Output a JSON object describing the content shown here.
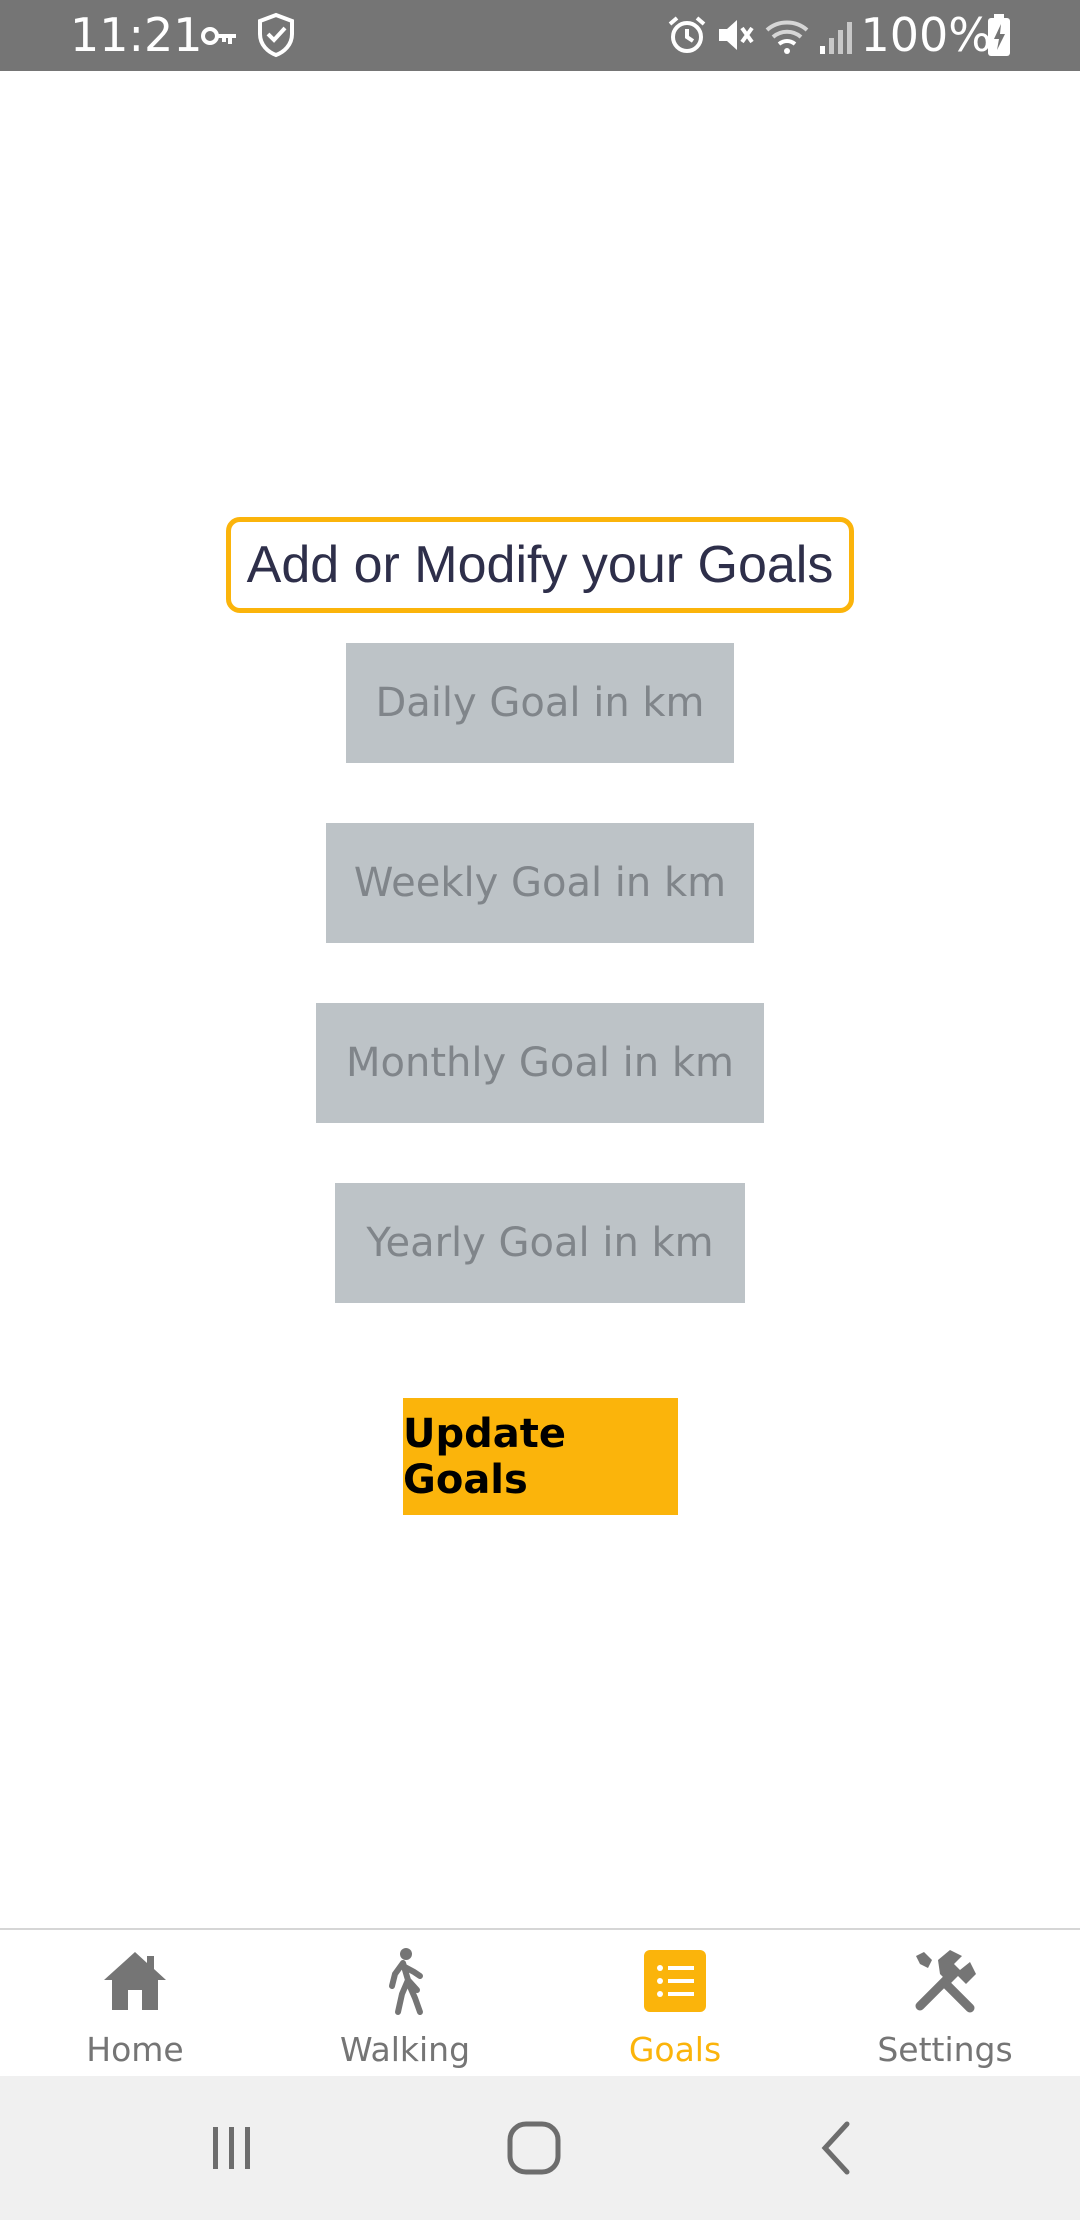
{
  "status_bar": {
    "time": "11:21",
    "battery": "100%",
    "icons": [
      "key-icon",
      "shield-check-icon",
      "alarm-icon",
      "mute-icon",
      "wifi-icon",
      "signal-icon",
      "battery-charging-icon"
    ]
  },
  "main": {
    "title": "Add or Modify your Goals",
    "daily_placeholder": "Daily Goal in km",
    "weekly_placeholder": "Weekly Goal in km",
    "monthly_placeholder": "Monthly Goal in km",
    "yearly_placeholder": "Yearly Goal in km",
    "update_button": "Update Goals"
  },
  "bottom_nav": {
    "items": [
      {
        "label": "Home",
        "icon": "home-icon"
      },
      {
        "label": "Walking",
        "icon": "walking-icon"
      },
      {
        "label": "Goals",
        "icon": "list-icon",
        "active": true
      },
      {
        "label": "Settings",
        "icon": "tools-icon"
      }
    ]
  },
  "colors": {
    "accent": "#fbb40b",
    "status_bar": "#757575",
    "input_bg": "#bdc3c7",
    "input_text": "#80858a",
    "title_text": "#2e2f4a",
    "nav_inactive": "#757575"
  }
}
